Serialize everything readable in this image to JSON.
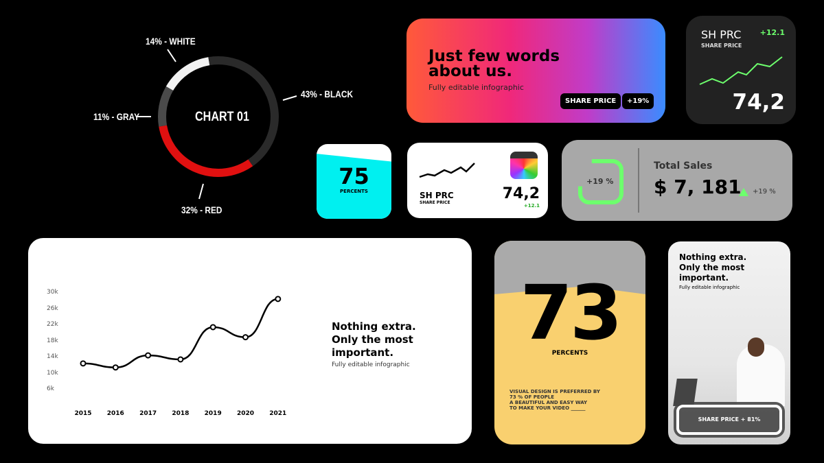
{
  "chart_data": [
    {
      "type": "pie",
      "title": "CHART 01",
      "labels": [
        "14% - WHITE",
        "43% - BLACK",
        "32% - RED",
        "11% - GRAY"
      ],
      "slices": [
        {
          "name": "WHITE",
          "value": 14,
          "color": "#f2f2f2"
        },
        {
          "name": "BLACK",
          "value": 43,
          "color": "#2a2a2a"
        },
        {
          "name": "RED",
          "value": 32,
          "color": "#e01010"
        },
        {
          "name": "GRAY",
          "value": 11,
          "color": "#4a4a4a"
        }
      ]
    },
    {
      "type": "line",
      "categories": [
        "2015",
        "2016",
        "2017",
        "2018",
        "2019",
        "2020",
        "2021"
      ],
      "values": [
        12.5,
        11.5,
        14.5,
        13.5,
        21.5,
        19,
        28.5
      ],
      "yticks": [
        "30k",
        "26k",
        "22k",
        "18k",
        "14k",
        "10k",
        "6k"
      ],
      "ylim": [
        6,
        30
      ],
      "grid": false
    }
  ],
  "hero": {
    "title": "Just few words about us.",
    "subtitle": "Fully editable infographic",
    "share_btn": "SHARE PRICE",
    "change_btn": "+19%"
  },
  "shprc_dark": {
    "title": "SH PRC",
    "subtitle": "SHARE PRICE",
    "change": "+12.1",
    "value": "74,2"
  },
  "percent_small": {
    "value": "75",
    "label": "PERCENTS",
    "fill": 0.75
  },
  "shprc_light": {
    "title": "SH PRC",
    "subtitle": "SHARE PRICE",
    "value": "74,2",
    "change": "+12.1"
  },
  "sales": {
    "ring_label": "+19 %",
    "title": "Total Sales",
    "value": "$ 7, 181",
    "change": "+19 %",
    "accent": "#6dff6d"
  },
  "line_card": {
    "heading_lines": [
      "Nothing extra.",
      "Only the most",
      "important."
    ],
    "subtitle": "Fully editable infographic"
  },
  "yellow": {
    "value": "73",
    "label": "PERCENTS",
    "text_lines": [
      "VISUAL DESIGN IS PREFERRED BY",
      "73 % OF PEOPLE",
      "A BEAUTIFUL AND EASY WAY",
      "TO MAKE YOUR VIDEO ______"
    ]
  },
  "photo": {
    "heading_lines": [
      "Nothing extra.",
      "Only the most",
      "important."
    ],
    "subtitle": "Fully editable infographic",
    "button": "SHARE PRICE + 81%"
  }
}
